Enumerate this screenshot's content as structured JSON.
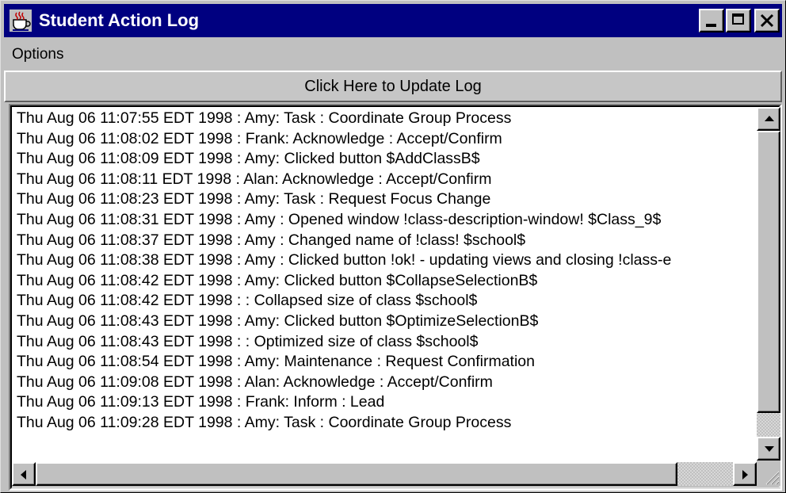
{
  "window": {
    "title": "Student Action Log",
    "colors": {
      "titlebar": "#000080",
      "chrome": "#c0c0c0",
      "log_background": "#ffffff"
    }
  },
  "menubar": {
    "items": [
      {
        "label": "Options"
      }
    ]
  },
  "update_button": {
    "label": "Click Here to Update Log"
  },
  "log": {
    "lines": [
      "Thu Aug 06 11:07:55 EDT 1998 : Amy: Task : Coordinate Group Process",
      "Thu Aug 06 11:08:02 EDT 1998 : Frank: Acknowledge : Accept/Confirm",
      "Thu Aug 06 11:08:09 EDT 1998 : Amy: Clicked button $AddClassB$",
      "Thu Aug 06 11:08:11 EDT 1998 : Alan: Acknowledge : Accept/Confirm",
      "Thu Aug 06 11:08:23 EDT 1998 : Amy: Task : Request Focus Change",
      "Thu Aug 06 11:08:31 EDT 1998 : Amy : Opened window !class-description-window! $Class_9$",
      "Thu Aug 06 11:08:37 EDT 1998 : Amy : Changed name of !class! $school$",
      "Thu Aug 06 11:08:38 EDT 1998 : Amy : Clicked button !ok! - updating views and closing !class-e",
      "Thu Aug 06 11:08:42 EDT 1998 : Amy: Clicked button $CollapseSelectionB$",
      "Thu Aug 06 11:08:42 EDT 1998 : : Collapsed size of class $school$",
      "Thu Aug 06 11:08:43 EDT 1998 : Amy: Clicked button $OptimizeSelectionB$",
      "Thu Aug 06 11:08:43 EDT 1998 : : Optimized size of class $school$",
      "Thu Aug 06 11:08:54 EDT 1998 : Amy: Maintenance : Request Confirmation",
      "Thu Aug 06 11:09:08 EDT 1998 : Alan: Acknowledge : Accept/Confirm",
      "Thu Aug 06 11:09:13 EDT 1998 : Frank: Inform : Lead",
      "Thu Aug 06 11:09:28 EDT 1998 : Amy: Task : Coordinate Group Process"
    ]
  },
  "icons": {
    "app": "java-coffee-cup-icon",
    "minimize": "minimize-icon",
    "maximize": "maximize-icon",
    "close": "close-icon",
    "scroll_up": "arrow-up-icon",
    "scroll_down": "arrow-down-icon",
    "scroll_left": "arrow-left-icon",
    "scroll_right": "arrow-right-icon"
  }
}
